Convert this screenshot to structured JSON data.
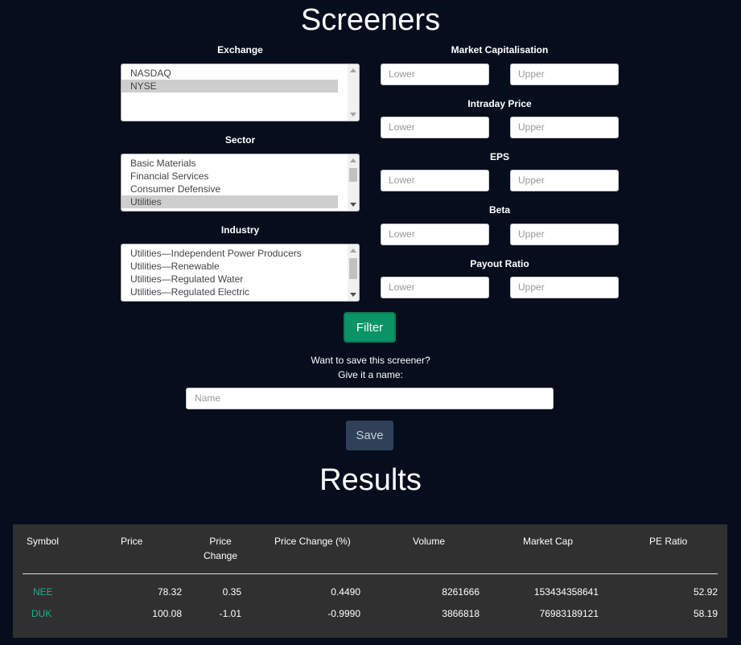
{
  "page": {
    "title": "Screeners",
    "results_title": "Results"
  },
  "exchange": {
    "label": "Exchange",
    "options": [
      "NASDAQ",
      "NYSE"
    ],
    "selected": "NYSE"
  },
  "sector": {
    "label": "Sector",
    "options": [
      "Basic Materials",
      "Financial Services",
      "Consumer Defensive",
      "Utilities"
    ],
    "selected": "Utilities"
  },
  "industry": {
    "label": "Industry",
    "options": [
      "Utilities—Independent Power Producers",
      "Utilities—Renewable",
      "Utilities—Regulated Water",
      "Utilities—Regulated Electric"
    ]
  },
  "ranges": [
    {
      "label": "Market Capitalisation",
      "lower_placeholder": "Lower",
      "upper_placeholder": "Upper"
    },
    {
      "label": "Intraday Price",
      "lower_placeholder": "Lower",
      "upper_placeholder": "Upper"
    },
    {
      "label": "EPS",
      "lower_placeholder": "Lower",
      "upper_placeholder": "Upper"
    },
    {
      "label": "Beta",
      "lower_placeholder": "Lower",
      "upper_placeholder": "Upper"
    },
    {
      "label": "Payout Ratio",
      "lower_placeholder": "Lower",
      "upper_placeholder": "Upper"
    }
  ],
  "filter_button": "Filter",
  "save": {
    "prompt_line1": "Want to save this screener?",
    "prompt_line2": "Give it a name:",
    "name_placeholder": "Name",
    "button": "Save"
  },
  "table": {
    "headers": [
      "Symbol",
      "Price",
      "Price Change",
      "Price Change (%)",
      "Volume",
      "Market Cap",
      "PE Ratio"
    ],
    "header_price_change_line1": "Price",
    "header_price_change_line2": "Change",
    "rows": [
      {
        "symbol": "NEE",
        "price": "78.32",
        "change": "0.35",
        "change_pct": "0.4490",
        "volume": "8261666",
        "market_cap": "153434358641",
        "pe": "52.92"
      },
      {
        "symbol": "DUK",
        "price": "100.08",
        "change": "-1.01",
        "change_pct": "-0.9990",
        "volume": "3866818",
        "market_cap": "76983189121",
        "pe": "58.19"
      }
    ]
  },
  "colors": {
    "background": "#060d1d",
    "accent": "#0a9466",
    "symbol": "#13b58a",
    "panel": "#303030"
  }
}
